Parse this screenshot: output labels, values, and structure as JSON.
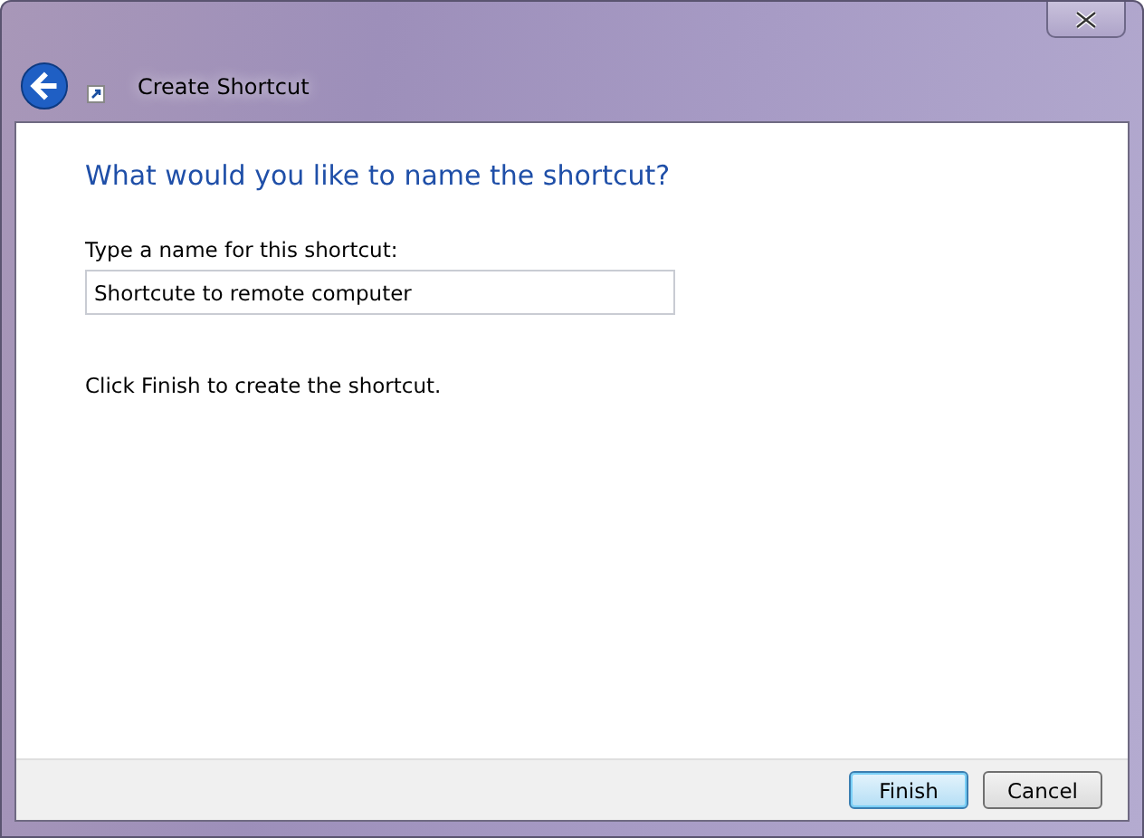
{
  "window": {
    "title": "Create Shortcut"
  },
  "heading": "What would you like to name the shortcut?",
  "name_field": {
    "label": "Type a name for this shortcut:",
    "value": "Shortcute to remote computer"
  },
  "instruction": "Click Finish to create the shortcut.",
  "buttons": [
    {
      "label": "Finish",
      "default": true
    },
    {
      "label": "Cancel",
      "default": false
    }
  ]
}
